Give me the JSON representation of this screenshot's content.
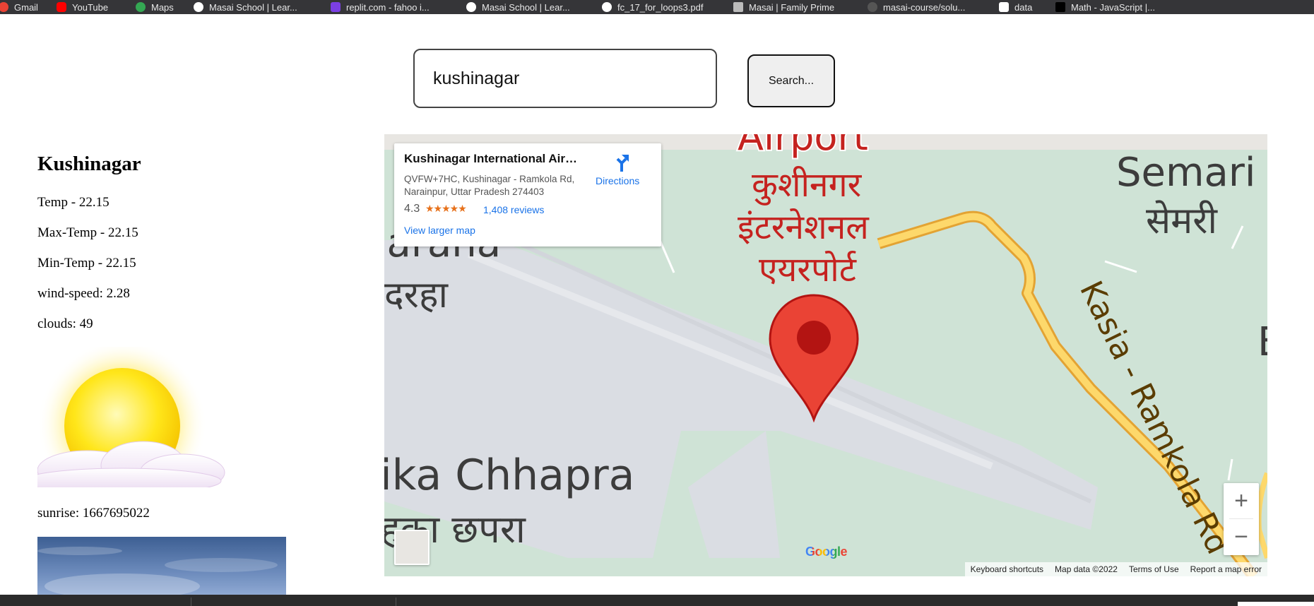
{
  "bookmarks": [
    {
      "label": "Gmail",
      "icon": "gmail-icon",
      "color": "#ea4335"
    },
    {
      "label": "YouTube",
      "icon": "youtube-icon",
      "color": "#ff0000"
    },
    {
      "label": "Maps",
      "icon": "maps-icon",
      "color": "#34a853"
    },
    {
      "label": "Masai School | Lear...",
      "icon": "masai-icon",
      "color": "#ffffff"
    },
    {
      "label": "replit.com - fahoo i...",
      "icon": "replit-icon",
      "color": "#7b3fe4"
    },
    {
      "label": "Masai School | Lear...",
      "icon": "masai-icon",
      "color": "#ffffff"
    },
    {
      "label": "fc_17_for_loops3.pdf",
      "icon": "pdf-icon",
      "color": "#ffffff"
    },
    {
      "label": "Masai | Family Prime",
      "icon": "page-icon",
      "color": "#bbbbbb"
    },
    {
      "label": "masai-course/solu...",
      "icon": "github-icon",
      "color": "#333333"
    },
    {
      "label": "data",
      "icon": "data-icon",
      "color": "#ffffff"
    },
    {
      "label": "Math - JavaScript |...",
      "icon": "mdn-icon",
      "color": "#000000"
    }
  ],
  "search": {
    "value": "kushinagar",
    "button_label": "Search..."
  },
  "weather": {
    "city": "Kushinagar",
    "temp": "Temp - 22.15",
    "max_temp": "Max-Temp - 22.15",
    "min_temp": "Min-Temp - 22.15",
    "wind_speed": "wind-speed: 2.28",
    "clouds": "clouds: 49",
    "weather_icon": "sun-behind-cloud-icon",
    "sunrise": "sunrise: 1667695022"
  },
  "map": {
    "place": {
      "name": "Kushinagar International Airp...",
      "address": "QVFW+7HC, Kushinagar - Ramkola Rd, Narainpur, Uttar Pradesh 274403",
      "rating": "4.3",
      "stars": "★★★★★",
      "reviews": "1,408 reviews",
      "larger_map": "View larger map",
      "directions": "Directions"
    },
    "labels": {
      "airport_en": "Airport",
      "airport_hi_1": "कुशीनगर",
      "airport_hi_2": "इंटरनेशनल",
      "airport_hi_3": "एयरपोर्ट",
      "semari_en": "Semari",
      "semari_hi": "सेमरी",
      "left_en": "larana",
      "left_hi": "दरहा",
      "chhapra_en": "ika Chhapra",
      "chhapra_hi": "हका छपरा",
      "road": "Kasia - Ramkola Rd",
      "edge_letter": "E"
    },
    "zoom_in": "+",
    "zoom_out": "−",
    "google": "Google",
    "attribution": {
      "shortcuts": "Keyboard shortcuts",
      "map_data": "Map data ©2022",
      "terms": "Terms of Use",
      "report": "Report a map error"
    },
    "colors": {
      "land": "#cfe3d6",
      "runway": "#dadde3",
      "road_fill": "#fdd86b",
      "road_border": "#e3a333",
      "marker": "#ea4335",
      "label_red": "#c5221f"
    }
  }
}
